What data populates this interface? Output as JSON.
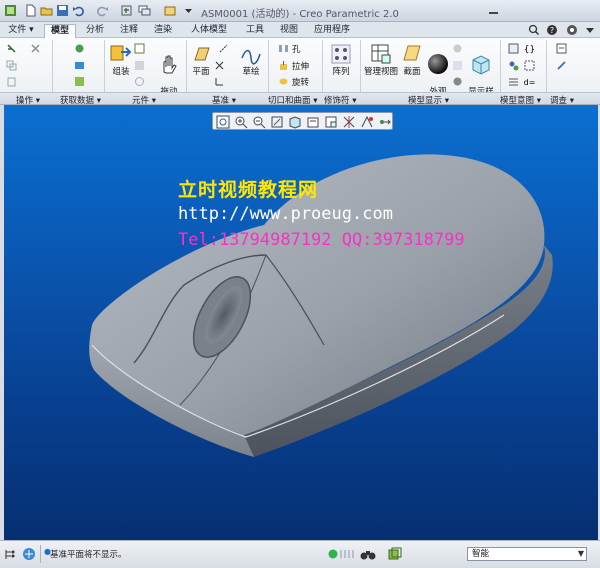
{
  "window": {
    "title": "ASM0001 (活动的) - Creo Parametric 2.0"
  },
  "tabs": [
    {
      "id": "file",
      "label": "文件 ▾"
    },
    {
      "id": "model",
      "label": "模型"
    },
    {
      "id": "analysis",
      "label": "分析"
    },
    {
      "id": "annotate",
      "label": "注释"
    },
    {
      "id": "render",
      "label": "渲染"
    },
    {
      "id": "manikin",
      "label": "人体模型"
    },
    {
      "id": "tools",
      "label": "工具"
    },
    {
      "id": "view",
      "label": "视图"
    },
    {
      "id": "apps",
      "label": "应用程序"
    }
  ],
  "ribbon": {
    "assemble_label": "组装",
    "drag_label": "拖动\n元件",
    "plane_label": "平面",
    "sketch_label": "草绘",
    "hole_label": "孔",
    "extrude_label": "拉伸",
    "revolve_label": "旋转",
    "pattern_label": "阵列",
    "manage_views_label": "管理视图",
    "section_label": "截面",
    "appearance_label": "外观\n库",
    "display_style_label": "显示样\n式"
  },
  "groups": [
    "操作 ▾",
    "获取数据 ▾",
    "元件 ▾",
    "基准 ▾",
    "切口和曲面 ▾",
    "修饰符 ▾",
    "模型显示 ▾",
    "模型意图 ▾",
    "调查 ▾"
  ],
  "watermark": {
    "title": "立时视频教程网",
    "url": "http://www.proeug.com",
    "contact": "Tel:13794987192  QQ:397318799"
  },
  "status": {
    "message": "基准平面将不显示。",
    "filter_value": "智能"
  },
  "colors": {
    "accent": "#1e6fc8",
    "viewport_top": "#0b6fd0",
    "viewport_bottom": "#062f72",
    "model": "#9aa0a8",
    "watermark_yellow": "#ffe600",
    "watermark_magenta": "#ff2dc8"
  }
}
